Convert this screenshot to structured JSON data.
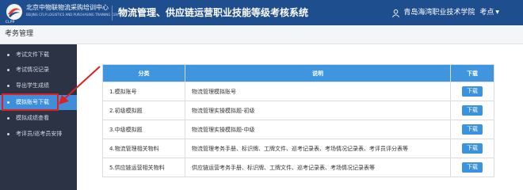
{
  "header": {
    "org_name_cn": "北京中物联物流采购培训中心",
    "org_name_en": "BEIJING CFLP LOGISTICS AND PURCHASING TRAINING CENTER",
    "logo_text": "CLPP",
    "app_title": "物流管理、供应链运营职业技能等级考核系统",
    "user_school": "青岛海湾职业技术学院",
    "user_role": "考点"
  },
  "breadcrumb": {
    "title": "考务管理"
  },
  "sidebar": {
    "items": [
      {
        "label": "考试文件下载",
        "active": false
      },
      {
        "label": "考试情况记录",
        "active": false
      },
      {
        "label": "导出学生成绩",
        "active": false
      },
      {
        "label": "模拟账号下载",
        "active": true
      },
      {
        "label": "模拟成绩查看",
        "active": false
      },
      {
        "label": "考评员/巡考员安排",
        "active": false
      }
    ]
  },
  "table": {
    "headers": [
      "分类",
      "说明",
      "下载"
    ],
    "rows": [
      {
        "category": "1.模拟账号",
        "description": "物流管理模拟账号",
        "action": "下载"
      },
      {
        "category": "2.初级模拟题",
        "description": "物流管理实操模拟题-初级",
        "action": "下载"
      },
      {
        "category": "3.中级模拟题",
        "description": "物流管理实操模拟题-中级",
        "action": "下载"
      },
      {
        "category": "4.物流管理相关物料",
        "description": "物流管理考务手册、标识牌、工牌文件、巡考记录表、考场情况记录表、考评员评分表等",
        "action": "下载"
      },
      {
        "category": "5.供应链运营相关物料",
        "description": "供应链运营考务手册、标识牌、工牌文件、巡考记录表、考场情况记录表等",
        "action": "下载"
      }
    ]
  },
  "colors": {
    "header_bg": "#1f4e8f",
    "sidebar_bg": "#2b3345",
    "active_item": "#3f8edb",
    "table_header": "#3f96df",
    "annotation_red": "#e02020"
  },
  "icons": [
    "logo-icon",
    "user-icon",
    "caret-down-icon"
  ]
}
